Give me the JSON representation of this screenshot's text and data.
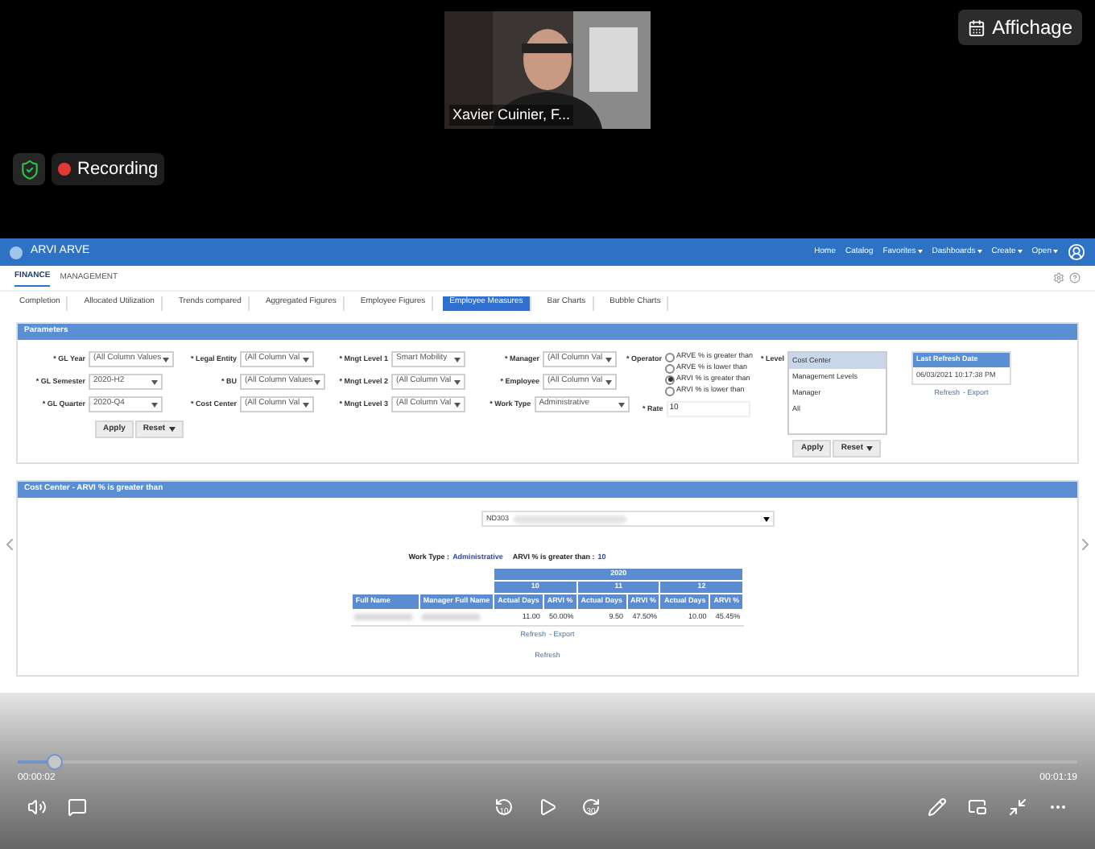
{
  "call": {
    "participant": "Xavier Cuinier, F...",
    "view_button": "Affichage",
    "recording": "Recording"
  },
  "app": {
    "title": "ARVI ARVE",
    "nav": [
      {
        "label": "Home",
        "dropdown": false
      },
      {
        "label": "Catalog",
        "dropdown": false
      },
      {
        "label": "Favorites",
        "dropdown": true
      },
      {
        "label": "Dashboards",
        "dropdown": true
      },
      {
        "label": "Create",
        "dropdown": true
      },
      {
        "label": "Open",
        "dropdown": true
      }
    ],
    "top_tabs": [
      {
        "label": "FINANCE",
        "selected": true
      },
      {
        "label": "MANAGEMENT",
        "selected": false
      }
    ],
    "sub_tabs": [
      {
        "label": "Completion",
        "selected": false
      },
      {
        "label": "Allocated Utilization",
        "selected": false
      },
      {
        "label": "Trends compared",
        "selected": false
      },
      {
        "label": "Aggregated Figures",
        "selected": false
      },
      {
        "label": "Employee Figures",
        "selected": false
      },
      {
        "label": "Employee Measures",
        "selected": true
      },
      {
        "label": "Bar Charts",
        "selected": false
      },
      {
        "label": "Bubble Charts",
        "selected": false
      }
    ],
    "parameters": {
      "title": "Parameters",
      "columns": [
        [
          {
            "label": "* GL Year",
            "value": "(All Column Values"
          },
          {
            "label": "* GL Semester",
            "value": "2020-H2"
          },
          {
            "label": "* GL Quarter",
            "value": "2020-Q4"
          }
        ],
        [
          {
            "label": "* Legal Entity",
            "value": "(All Column Val"
          },
          {
            "label": "* BU",
            "value": "(All Column Values"
          },
          {
            "label": "* Cost Center",
            "value": "(All Column Val"
          }
        ],
        [
          {
            "label": "* Mngt Level 1",
            "value": "Smart Mobility"
          },
          {
            "label": "* Mngt Level 2",
            "value": "(All Column Val"
          },
          {
            "label": "* Mngt Level 3",
            "value": "(All Column Val"
          }
        ],
        [
          {
            "label": "* Manager",
            "value": "(All Column Val"
          },
          {
            "label": "* Employee",
            "value": "(All Column Val"
          },
          {
            "label": "* Work Type",
            "value": "Administrative"
          }
        ]
      ],
      "buttons": [
        "Apply",
        "Reset"
      ],
      "operator": {
        "label": "* Operator",
        "options": [
          {
            "label": "ARVE % is greater than",
            "selected": false
          },
          {
            "label": "ARVE % is lower than",
            "selected": false
          },
          {
            "label": "ARVI % is greater than",
            "selected": true
          },
          {
            "label": "ARVI % is lower than",
            "selected": false
          }
        ]
      },
      "rate": {
        "label": "* Rate",
        "value": "10"
      },
      "level": {
        "label": "* Level",
        "options": [
          {
            "label": "Cost Center",
            "selected": true
          },
          {
            "label": "Management Levels",
            "selected": false
          },
          {
            "label": "Manager",
            "selected": false
          },
          {
            "label": "All",
            "selected": false
          }
        ]
      },
      "buttons_2": [
        "Apply",
        "Reset"
      ],
      "refresh_box": {
        "title": "Last Refresh Date",
        "value": "06/03/2021 10:17:38 PM",
        "links": [
          "Refresh",
          "- Export"
        ]
      }
    },
    "report": {
      "title": "Cost Center - ARVI % is greater than",
      "dropdown_value": "ND303",
      "filters": [
        {
          "label": "Work Type :",
          "value": "Administrative"
        },
        {
          "label": "ARVI % is greater than :",
          "value": "10"
        }
      ],
      "table": {
        "year": "2020",
        "months": [
          "10",
          "11",
          "12"
        ],
        "columns": [
          "Full Name",
          "Manager Full Name",
          "Actual Days",
          "ARVI %",
          "Actual Days",
          "ARVI %",
          "Actual Days",
          "ARVI %"
        ],
        "rows": [
          {
            "cells": [
              "",
              "",
              "11.00",
              "50.00%",
              "9.50",
              "47.50%",
              "10.00",
              "45.45%"
            ]
          }
        ]
      },
      "links": [
        "Refresh",
        "- Export"
      ],
      "footer_link": "Refresh"
    }
  },
  "player": {
    "elapsed": "00:00:02",
    "total": "00:01:19",
    "level": 0.035,
    "skip_back": "10",
    "skip_forward": "30"
  }
}
